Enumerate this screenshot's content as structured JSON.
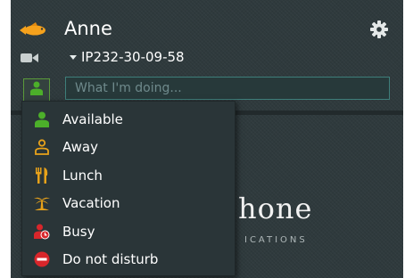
{
  "header": {
    "user_name": "Anne",
    "account": "IP232-30-09-58"
  },
  "status": {
    "placeholder": "What I'm doing...",
    "value": ""
  },
  "status_menu": {
    "items": [
      {
        "label": "Available",
        "icon": "available-person-icon",
        "color": "#4caf2a"
      },
      {
        "label": "Away",
        "icon": "away-person-icon",
        "color": "#e8a21a"
      },
      {
        "label": "Lunch",
        "icon": "fork-knife-icon",
        "color": "#e8a21a"
      },
      {
        "label": "Vacation",
        "icon": "palm-tree-icon",
        "color": "#e8a21a"
      },
      {
        "label": "Busy",
        "icon": "busy-person-clock-icon",
        "color": "#d8262b"
      },
      {
        "label": "Do not disturb",
        "icon": "no-entry-icon",
        "color": "#d8262b"
      }
    ]
  },
  "brand": {
    "name": "hone",
    "subtitle": "ICATIONS"
  },
  "colors": {
    "background": "#2f3a3d",
    "input_border": "#3e7e7a",
    "available": "#4caf2a",
    "away": "#e8a21a",
    "busy": "#d8262b"
  }
}
